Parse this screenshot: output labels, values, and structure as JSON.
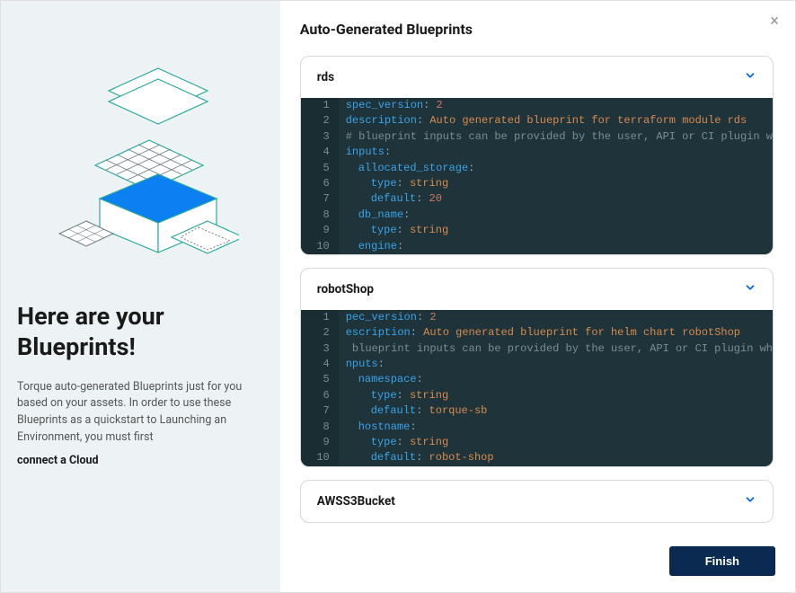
{
  "left": {
    "heading_line1": "Here are your",
    "heading_line2": "Blueprints!",
    "description": "Torque auto-generated Blueprints just for you based on your assets. In order to use these Blueprints as a quickstart to Launching an Environment, you must first",
    "link_text": "connect a Cloud"
  },
  "right": {
    "title": "Auto-Generated Blueprints",
    "finish_label": "Finish"
  },
  "blueprints": [
    {
      "name": "rds",
      "expanded": true,
      "code": [
        {
          "n": "1",
          "tokens": [
            {
              "t": "key",
              "v": "spec_version"
            },
            {
              "t": "colon",
              "v": ": "
            },
            {
              "t": "num",
              "v": "2"
            }
          ]
        },
        {
          "n": "2",
          "tokens": [
            {
              "t": "key",
              "v": "description"
            },
            {
              "t": "colon",
              "v": ": "
            },
            {
              "t": "str",
              "v": "Auto generated blueprint for terraform module rds"
            }
          ]
        },
        {
          "n": "3",
          "tokens": [
            {
              "t": "comment",
              "v": "# blueprint inputs can be provided by the user, API or CI plugin w"
            }
          ]
        },
        {
          "n": "4",
          "tokens": [
            {
              "t": "key",
              "v": "inputs"
            },
            {
              "t": "colon",
              "v": ":"
            }
          ]
        },
        {
          "n": "5",
          "indent": 2,
          "tokens": [
            {
              "t": "key",
              "v": "allocated_storage"
            },
            {
              "t": "colon",
              "v": ":"
            }
          ]
        },
        {
          "n": "6",
          "indent": 3,
          "tokens": [
            {
              "t": "key",
              "v": "type"
            },
            {
              "t": "colon",
              "v": ": "
            },
            {
              "t": "str",
              "v": "string"
            }
          ]
        },
        {
          "n": "7",
          "indent": 3,
          "tokens": [
            {
              "t": "key",
              "v": "default"
            },
            {
              "t": "colon",
              "v": ": "
            },
            {
              "t": "num",
              "v": "20"
            }
          ]
        },
        {
          "n": "8",
          "indent": 2,
          "tokens": [
            {
              "t": "key",
              "v": "db_name"
            },
            {
              "t": "colon",
              "v": ":"
            }
          ]
        },
        {
          "n": "9",
          "indent": 3,
          "tokens": [
            {
              "t": "key",
              "v": "type"
            },
            {
              "t": "colon",
              "v": ": "
            },
            {
              "t": "str",
              "v": "string"
            }
          ]
        },
        {
          "n": "10",
          "indent": 2,
          "tokens": [
            {
              "t": "key",
              "v": "engine"
            },
            {
              "t": "colon",
              "v": ":"
            }
          ]
        }
      ]
    },
    {
      "name": "robotShop",
      "expanded": true,
      "code": [
        {
          "n": "1",
          "tokens": [
            {
              "t": "key",
              "v": "pec_version"
            },
            {
              "t": "colon",
              "v": ": "
            },
            {
              "t": "num",
              "v": "2"
            }
          ]
        },
        {
          "n": "2",
          "tokens": [
            {
              "t": "key",
              "v": "escription"
            },
            {
              "t": "colon",
              "v": ": "
            },
            {
              "t": "str",
              "v": "Auto generated blueprint for helm chart robotShop"
            }
          ]
        },
        {
          "n": "3",
          "tokens": [
            {
              "t": "comment",
              "v": " blueprint inputs can be provided by the user, API or CI plugin wh"
            }
          ]
        },
        {
          "n": "4",
          "tokens": [
            {
              "t": "key",
              "v": "nputs"
            },
            {
              "t": "colon",
              "v": ":"
            }
          ]
        },
        {
          "n": "5",
          "indent": 2,
          "tokens": [
            {
              "t": "key",
              "v": "namespace"
            },
            {
              "t": "colon",
              "v": ":"
            }
          ]
        },
        {
          "n": "6",
          "indent": 3,
          "tokens": [
            {
              "t": "key",
              "v": "type"
            },
            {
              "t": "colon",
              "v": ": "
            },
            {
              "t": "str",
              "v": "string"
            }
          ]
        },
        {
          "n": "7",
          "indent": 3,
          "tokens": [
            {
              "t": "key",
              "v": "default"
            },
            {
              "t": "colon",
              "v": ": "
            },
            {
              "t": "str",
              "v": "torque-sb"
            }
          ]
        },
        {
          "n": "8",
          "indent": 2,
          "tokens": [
            {
              "t": "key",
              "v": "hostname"
            },
            {
              "t": "colon",
              "v": ":"
            }
          ]
        },
        {
          "n": "9",
          "indent": 3,
          "tokens": [
            {
              "t": "key",
              "v": "type"
            },
            {
              "t": "colon",
              "v": ": "
            },
            {
              "t": "str",
              "v": "string"
            }
          ]
        },
        {
          "n": "10",
          "indent": 3,
          "tokens": [
            {
              "t": "key",
              "v": "default"
            },
            {
              "t": "colon",
              "v": ": "
            },
            {
              "t": "str",
              "v": "robot-shop"
            }
          ]
        }
      ]
    },
    {
      "name": "AWSS3Bucket",
      "expanded": false,
      "code": []
    }
  ]
}
